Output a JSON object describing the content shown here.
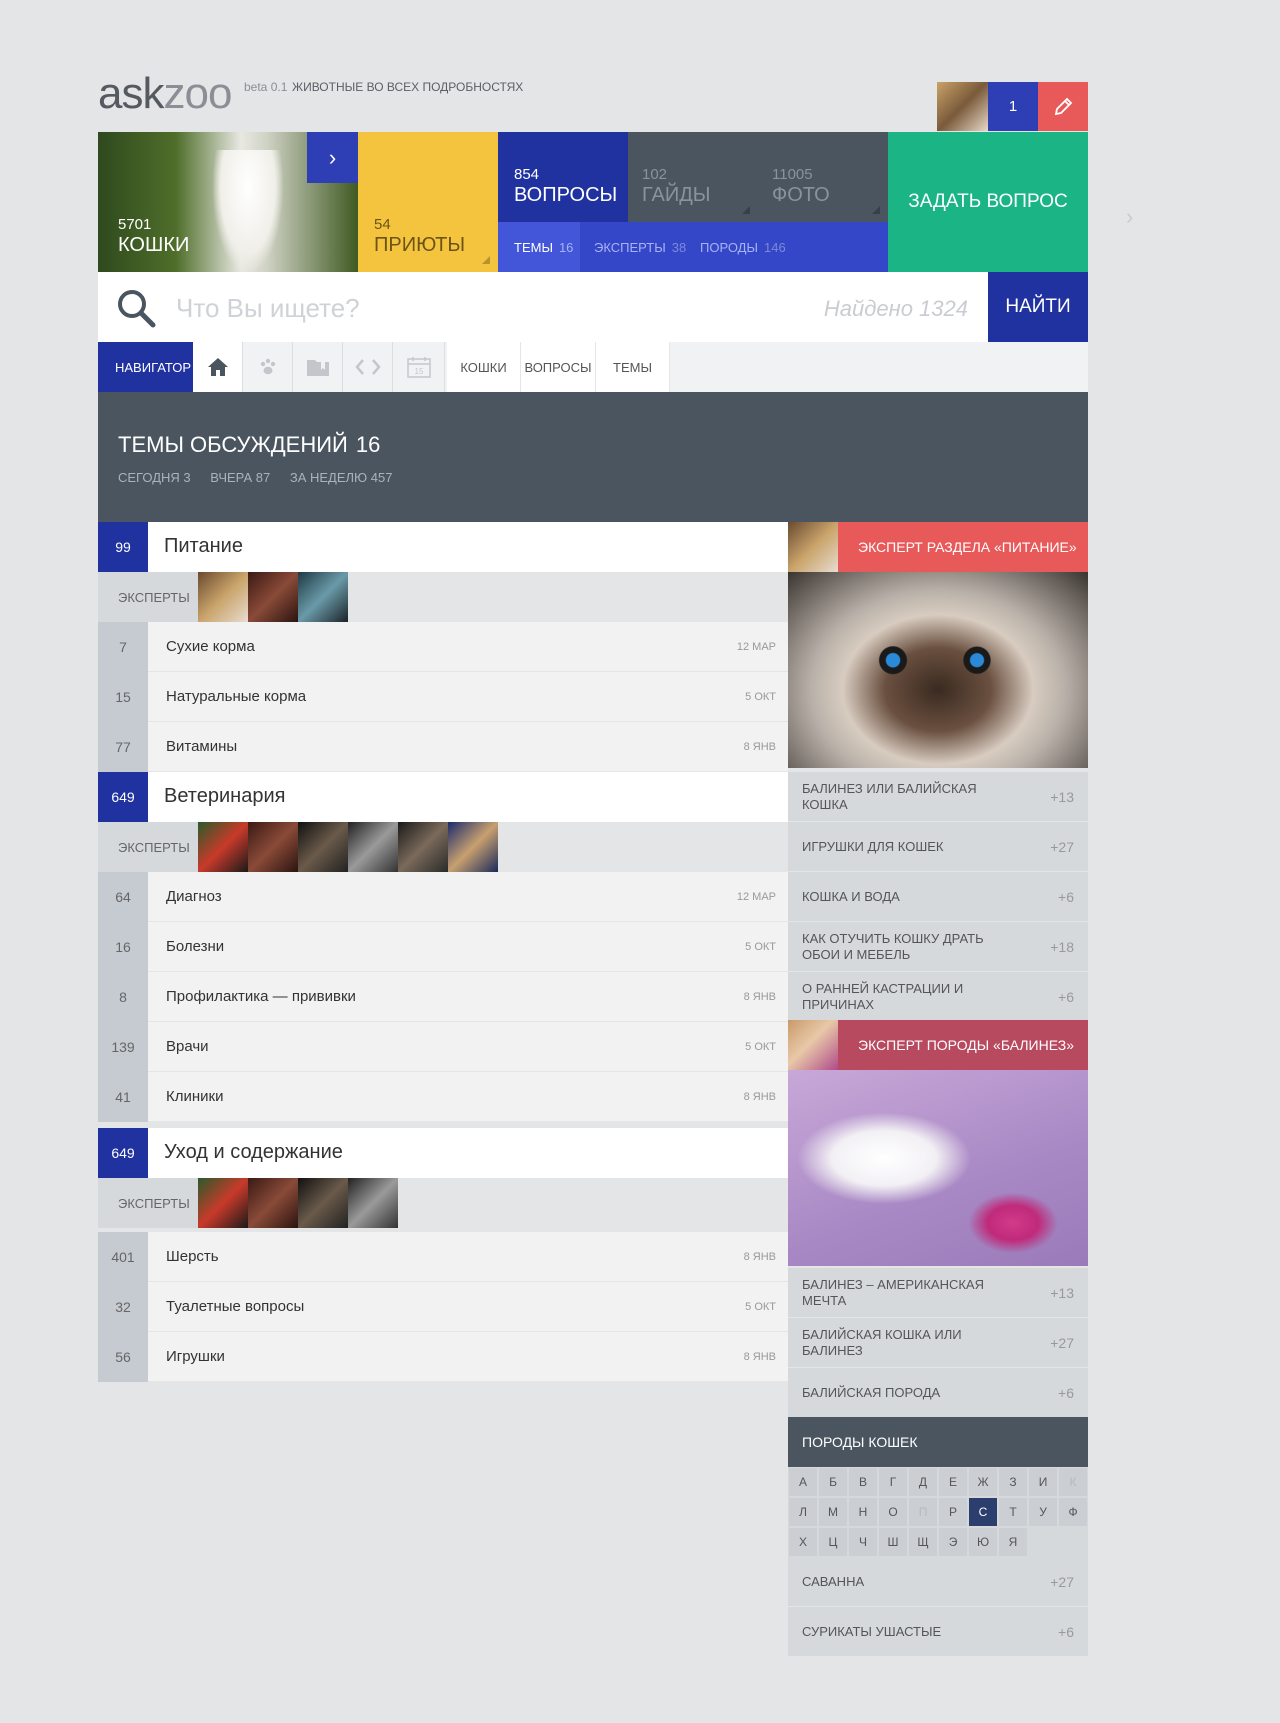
{
  "header": {
    "logo_a": "ask",
    "logo_b": "zoo",
    "beta": "beta 0.1",
    "tagline": "ЖИВОТНЫЕ ВО ВСЕХ ПОДРОБНОСТЯХ",
    "notifications": "1"
  },
  "tiles": {
    "cats": {
      "count": "5701",
      "label": "КОШКИ"
    },
    "shelters": {
      "count": "54",
      "label": "ПРИЮТЫ"
    },
    "questions": {
      "count": "854",
      "label": "ВОПРОСЫ"
    },
    "guides": {
      "count": "102",
      "label": "ГАЙДЫ"
    },
    "photos": {
      "count": "11005",
      "label": "ФОТО"
    },
    "ask": "ЗАДАТЬ ВОПРОС"
  },
  "subtabs": [
    {
      "label": "ТЕМЫ",
      "count": "16"
    },
    {
      "label": "ЭКСПЕРТЫ",
      "count": "38"
    },
    {
      "label": "ПОРОДЫ",
      "count": "146"
    }
  ],
  "search": {
    "placeholder": "Что Вы ищете?",
    "found": "Найдено 1324",
    "button": "НАЙТИ"
  },
  "navigator": {
    "label": "НАВИГАТОР",
    "calendar_day": "15",
    "crumbs": [
      "КОШКИ",
      "ВОПРОСЫ",
      "ТЕМЫ"
    ]
  },
  "topics": {
    "title": "ТЕМЫ ОБСУЖДЕНИЙ",
    "count": "16",
    "today": "СЕГОДНЯ 3",
    "yesterday": "ВЧЕРА 87",
    "week": "ЗА НЕДЕЛЮ 457"
  },
  "experts_label": "ЭКСПЕРТЫ",
  "categories": [
    {
      "count": "99",
      "name": "Питание",
      "items": [
        {
          "count": "7",
          "name": "Сухие корма",
          "date": "12 МАР"
        },
        {
          "count": "15",
          "name": "Натуральные корма",
          "date": "5 ОКТ"
        },
        {
          "count": "77",
          "name": "Витамины",
          "date": "8 ЯНВ"
        }
      ]
    },
    {
      "count": "649",
      "name": "Ветеринария",
      "items": [
        {
          "count": "64",
          "name": "Диагноз",
          "date": "12 МАР"
        },
        {
          "count": "16",
          "name": "Болезни",
          "date": "5 ОКТ"
        },
        {
          "count": "8",
          "name": "Профилактика — прививки",
          "date": "8 ЯНВ"
        },
        {
          "count": "139",
          "name": "Врачи",
          "date": "5 ОКТ"
        },
        {
          "count": "41",
          "name": "Клиники",
          "date": "8 ЯНВ"
        }
      ]
    },
    {
      "count": "649",
      "name": "Уход и содержание",
      "items": [
        {
          "count": "401",
          "name": "Шерсть",
          "date": "8 ЯНВ"
        },
        {
          "count": "32",
          "name": "Туалетные вопросы",
          "date": "5 ОКТ"
        },
        {
          "count": "56",
          "name": "Игрушки",
          "date": "8 ЯНВ"
        }
      ]
    }
  ],
  "sidebar": {
    "expert1_title": "ЭКСПЕРТ РАЗДЕЛА «ПИТАНИЕ»",
    "links1": [
      {
        "name": "БАЛИНЕЗ ИЛИ БАЛИЙСКАЯ КОШКА",
        "score": "+13"
      },
      {
        "name": "ИГРУШКИ ДЛЯ КОШЕК",
        "score": "+27"
      },
      {
        "name": "КОШКА И ВОДА",
        "score": "+6"
      },
      {
        "name": "КАК ОТУЧИТЬ КОШКУ ДРАТЬ ОБОИ И МЕБЕЛЬ",
        "score": "+18"
      },
      {
        "name": "О РАННЕЙ КАСТРАЦИИ И ПРИЧИНАХ",
        "score": "+6"
      }
    ],
    "expert2_title": "ЭКСПЕРТ ПОРОДЫ «БАЛИНЕЗ»",
    "links2": [
      {
        "name": "БАЛИНЕЗ – АМЕРИКАНСКАЯ МЕЧТА",
        "score": "+13"
      },
      {
        "name": "БАЛИЙСКАЯ КОШКА ИЛИ БАЛИНЕЗ",
        "score": "+27"
      },
      {
        "name": "БАЛИЙСКАЯ ПОРОДА",
        "score": "+6"
      }
    ],
    "breeds_title": "ПОРОДЫ КОШЕК",
    "letters": [
      "А",
      "Б",
      "В",
      "Г",
      "Д",
      "Е",
      "Ж",
      "З",
      "И",
      "К",
      "Л",
      "М",
      "Н",
      "О",
      "П",
      "Р",
      "С",
      "Т",
      "У",
      "Ф",
      "Х",
      "Ц",
      "Ч",
      "Ш",
      "Щ",
      "Э",
      "Ю",
      "Я"
    ],
    "breeds": [
      {
        "name": "САВАННА",
        "score": "+27"
      },
      {
        "name": "СУРИКАТЫ УШАСТЫЕ",
        "score": "+6"
      }
    ]
  },
  "colors": {
    "blue": "#2032a0",
    "yellow": "#f5c43e",
    "green": "#1bb585",
    "red": "#e85a5a",
    "slate": "#4a5560"
  }
}
